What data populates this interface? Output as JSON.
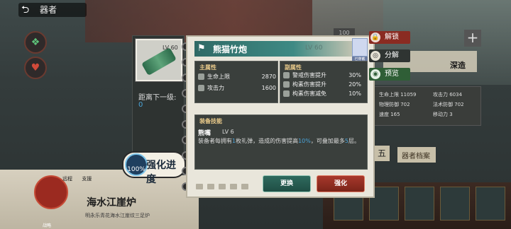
{
  "nav": {
    "back_label": "器者",
    "back_icon": "back-arrow-icon"
  },
  "background": {
    "right_stats": [
      "生命上限 11059",
      "攻击力 6034",
      "物理防御 702",
      "法术防御 702",
      "速度 165",
      "移动力 3"
    ],
    "deco_label": "深造",
    "archive_label": "器者档案",
    "wu_char": "五",
    "poster_title": "海水江崖炉",
    "poster_sub": "明永乐青花海水江崖纹三足炉",
    "poster_tabs": [
      "远程",
      "支援"
    ],
    "stamp_label": "战略",
    "num_badge": "100"
  },
  "item_card": {
    "level": "LV 60",
    "distance_label": "距离下一级:",
    "distance_value": "0",
    "enhance_percent": "100%",
    "enhance_label": "强化进度"
  },
  "panel": {
    "item_name": "熊猫竹炮",
    "level": "LV 60",
    "avatar_tag": "已穿戴",
    "main_attr": {
      "title": "主属性",
      "rows": [
        {
          "label": "生命上限",
          "value": "2870"
        },
        {
          "label": "攻击力",
          "value": "1600"
        }
      ]
    },
    "sub_attr": {
      "title": "副属性",
      "rows": [
        {
          "label": "警戒伤害提升",
          "value": "30%"
        },
        {
          "label": "构素伤害提升",
          "value": "20%"
        },
        {
          "label": "构素伤害减免",
          "value": "10%"
        }
      ]
    },
    "skill": {
      "title": "装备技能",
      "name": "熊嘴",
      "level": "LV 6",
      "desc_a": "装备者每拥有",
      "desc_hl1": "1",
      "desc_b": "枚礼弹，造成的伤害提高",
      "desc_hl2": "10%",
      "desc_c": "，可叠加最多",
      "desc_hl3": "5",
      "desc_d": "层。"
    },
    "buttons": {
      "swap": "更换",
      "enhance": "强化"
    }
  },
  "actions": {
    "unlock": "解锁",
    "split": "分解",
    "preview": "预览"
  },
  "colors": {
    "accent_teal": "#2f6a66",
    "enhance_red": "#a8382c",
    "highlight_blue": "#4aa3d8"
  }
}
